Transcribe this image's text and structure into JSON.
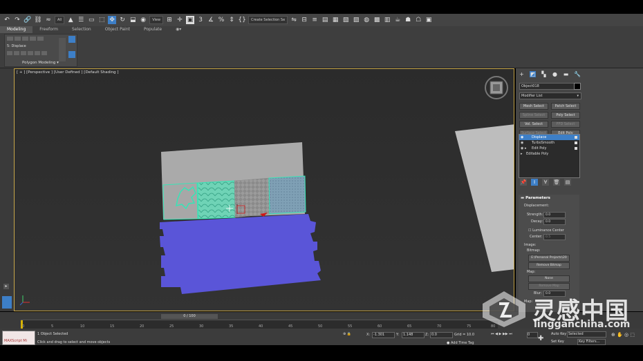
{
  "toolbar": {
    "filter_dropdown": "All",
    "view_dropdown": "View",
    "selection_set": "Create Selection Se",
    "snap_value": "3"
  },
  "ribbon": {
    "tabs": [
      "Modeling",
      "Freeform",
      "Selection",
      "Object Paint",
      "Populate"
    ],
    "panel_label": "Polygon Modeling",
    "modifier_label": "5: Displace"
  },
  "viewport": {
    "label": "[ + ] [Perspective ] [User Defined ] [Default Shading ]"
  },
  "command_panel": {
    "object_name": "Object018",
    "modifier_list": "Modifier List",
    "buttons": [
      {
        "label": "Mesh Select",
        "dim": false
      },
      {
        "label": "Patch Select",
        "dim": false
      },
      {
        "label": "Spline Select",
        "dim": true
      },
      {
        "label": "Poly Select",
        "dim": false
      },
      {
        "label": "Vol. Select",
        "dim": false
      },
      {
        "label": "FFD Select",
        "dim": true
      },
      {
        "label": "Surface Select",
        "dim": true
      },
      {
        "label": "Edit Poly",
        "dim": false
      }
    ],
    "stack": [
      "Displace",
      "TurboSmooth",
      "Edit Poly",
      "Editable Poly"
    ],
    "params": {
      "header": "Parameters",
      "displacement_label": "Displacement:",
      "strength_label": "Strength:",
      "strength_value": "0.0",
      "decay_label": "Decay:",
      "decay_value": "0.0",
      "luminance_label": "Luminance Center",
      "center_label": "Center:",
      "center_value": "0.5",
      "image_label": "Image:",
      "bitmap_label": "Bitmap:",
      "bitmap_path": "E:\\Personal Projects\\20",
      "remove_bitmap": "Remove Bitmap",
      "map_label": "Map:",
      "map_none": "None",
      "remove_map": "Remove Map",
      "blur_label": "Blur:",
      "blur_value": "0.0",
      "map2_label": "Map:"
    }
  },
  "timeline": {
    "slider_label": "0 / 100",
    "ticks": [
      "0",
      "5",
      "10",
      "15",
      "20",
      "25",
      "30",
      "35",
      "40",
      "45",
      "50",
      "55",
      "60",
      "65",
      "70",
      "75",
      "80"
    ]
  },
  "status": {
    "maxscript": "MAXScript Mi",
    "selected": "1 Object Selected",
    "prompt": "Click and drag to select and move objects",
    "x_label": "X:",
    "x_value": "-1.301",
    "y_label": "Y:",
    "y_value": "1.148",
    "z_label": "Z:",
    "z_value": "0.0",
    "grid": "Grid = 10.0",
    "add_time_tag": "Add Time Tag",
    "auto_key": "Auto Key",
    "selected_dropdown": "Selected",
    "set_key": "Set Key",
    "key_filters": "Key Filters...",
    "frame": "0"
  },
  "watermark": {
    "cn": "灵感中国",
    "url": "lingganchina.com"
  }
}
